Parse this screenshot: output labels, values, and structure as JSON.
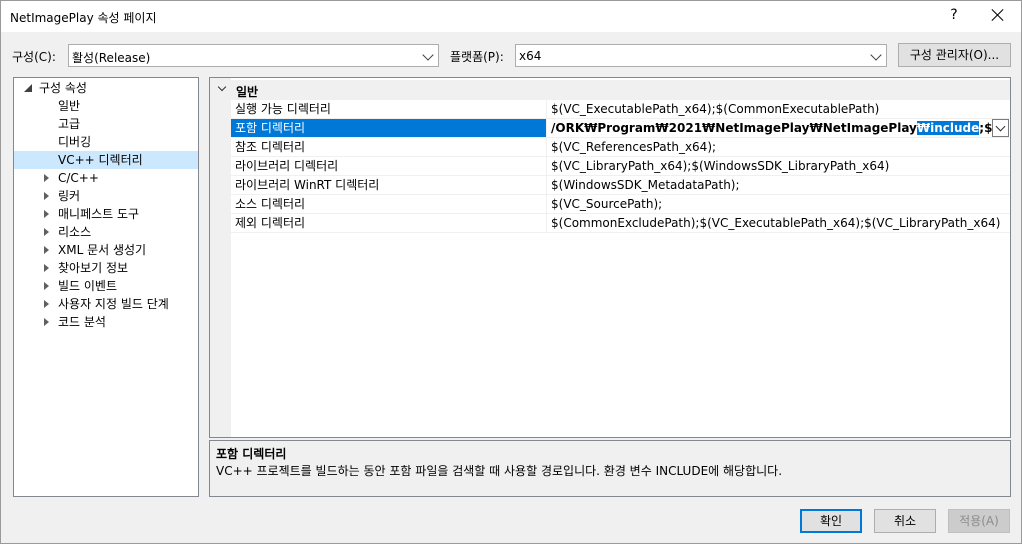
{
  "window": {
    "title": "NetImagePlay 속성 페이지",
    "help": "?"
  },
  "config": {
    "config_label": "구성(C):",
    "config_value": "활성(Release)",
    "platform_label": "플랫폼(P):",
    "platform_value": "x64",
    "manager_button": "구성 관리자(O)..."
  },
  "tree": {
    "root": "구성 속성",
    "items": [
      {
        "label": "일반"
      },
      {
        "label": "고급"
      },
      {
        "label": "디버깅"
      },
      {
        "label": "VC++ 디렉터리"
      },
      {
        "label": "C/C++"
      },
      {
        "label": "링커"
      },
      {
        "label": "매니페스트 도구"
      },
      {
        "label": "리소스"
      },
      {
        "label": "XML 문서 생성기"
      },
      {
        "label": "찾아보기 정보"
      },
      {
        "label": "빌드 이벤트"
      },
      {
        "label": "사용자 지정 빌드 단계"
      },
      {
        "label": "코드 분석"
      }
    ]
  },
  "grid": {
    "category": "일반",
    "rows": [
      {
        "name": "실행 가능 디렉터리",
        "value": "$(VC_ExecutablePath_x64);$(CommonExecutablePath)"
      },
      {
        "name": "포함 디렉터리",
        "value_pre": "/ORK₩Program₩2021₩NetImagePlay₩NetImagePlay",
        "value_hl": "₩include",
        "value_post": ";$(IncludePath)"
      },
      {
        "name": "참조 디렉터리",
        "value": "$(VC_ReferencesPath_x64);"
      },
      {
        "name": "라이브러리 디렉터리",
        "value": "$(VC_LibraryPath_x64);$(WindowsSDK_LibraryPath_x64)"
      },
      {
        "name": "라이브러리 WinRT 디렉터리",
        "value": "$(WindowsSDK_MetadataPath);"
      },
      {
        "name": "소스 디렉터리",
        "value": "$(VC_SourcePath);"
      },
      {
        "name": "제외 디렉터리",
        "value": "$(CommonExcludePath);$(VC_ExecutablePath_x64);$(VC_LibraryPath_x64)"
      }
    ]
  },
  "description": {
    "title": "포함 디렉터리",
    "text": "VC++ 프로젝트를 빌드하는 동안 포함 파일을 검색할 때 사용할 경로입니다.  환경 변수 INCLUDE에 해당합니다."
  },
  "buttons": {
    "ok": "확인",
    "cancel": "취소",
    "apply": "적용(A)"
  }
}
